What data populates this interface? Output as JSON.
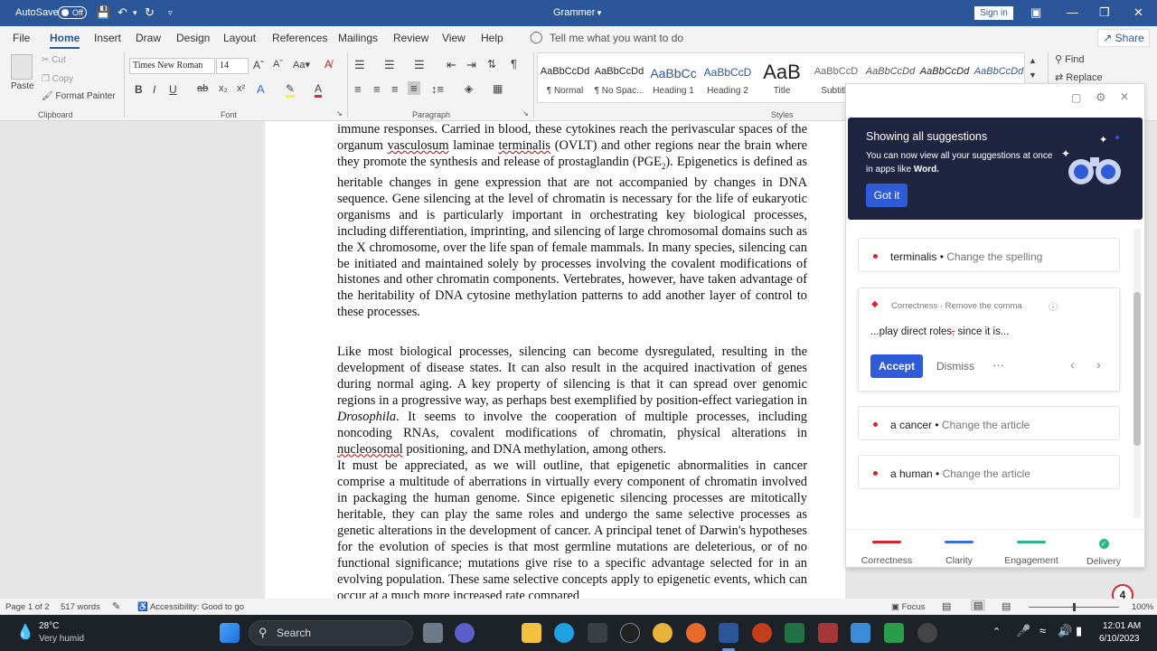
{
  "titlebar": {
    "autosave": "AutoSave",
    "toggle": "Off",
    "title": "Grammer",
    "signin": "Sign in"
  },
  "tabs": [
    "File",
    "Home",
    "Insert",
    "Draw",
    "Design",
    "Layout",
    "References",
    "Mailings",
    "Review",
    "View",
    "Help"
  ],
  "tellme": "Tell me what you want to do",
  "share": "Share",
  "ribbon": {
    "clipboard": {
      "paste": "Paste",
      "cut": "Cut",
      "copy": "Copy",
      "format_painter": "Format Painter",
      "label": "Clipboard"
    },
    "font": {
      "name": "Times New Roman",
      "size": "14",
      "label": "Font"
    },
    "paragraph": {
      "label": "Paragraph"
    },
    "styles": {
      "label": "Styles",
      "items": [
        {
          "preview": "AaBbCcDd",
          "name": "¶ Normal"
        },
        {
          "preview": "AaBbCcDd",
          "name": "¶ No Spac..."
        },
        {
          "preview": "AaBbCc",
          "name": "Heading 1"
        },
        {
          "preview": "AaBbCcD",
          "name": "Heading 2"
        },
        {
          "preview": "AaB",
          "name": "Title"
        },
        {
          "preview": "AaBbCcD",
          "name": "Subtitle"
        },
        {
          "preview": "AaBbCcDd",
          "name": ""
        },
        {
          "preview": "AaBbCcDd",
          "name": ""
        },
        {
          "preview": "AaBbCcDd",
          "name": ""
        }
      ]
    },
    "editing": {
      "find": "Find",
      "replace": "Replace"
    }
  },
  "document": {
    "p1_a": "immune responses. Carried in blood, these cytokines reach the perivascular spaces of the organum ",
    "p1_sq1": "vasculosum",
    "p1_b": " laminae ",
    "p1_sq2": "terminalis",
    "p1_c": " (OVLT) and other regions near the brain where they promote the synthesis and release of prostaglandin (PGE",
    "p1_sub": "2",
    "p1_d": "). Epigenetics is defined as heritable changes in gene expression that are not accompanied by changes in DNA sequence. Gene silencing at the level of chromatin is necessary for the life of eukaryotic organisms and is particularly important in orchestrating key biological processes, including differentiation, imprinting, and silencing of large chromosomal domains such as the X chromosome, over the life span of female mammals. In many species, silencing can be initiated and maintained solely by processes involving the covalent modifications of histones and other chromatin components. Vertebrates, however, have taken advantage of the heritability of DNA cytosine methylation patterns to add another layer of control to these processes.",
    "p2_a": "Like most biological processes, silencing can become dysregulated, resulting in the development of disease states. It can also result in the acquired inactivation of genes during normal aging. A key property of silencing is that it can spread over genomic regions in a progressive way, as perhaps best exemplified by position-effect variegation in ",
    "p2_it": "Drosophila",
    "p2_b": ". It seems to involve the cooperation of multiple processes, including noncoding RNAs, covalent modifications of chromatin, physical alterations in ",
    "p2_sq": "nucleosomal",
    "p2_c": " positioning, and DNA methylation, among others.",
    "p3": "It must be appreciated, as we will outline, that epigenetic abnormalities in cancer comprise a multitude of aberrations in virtually every component of chromatin involved in packaging the human genome. Since epigenetic silencing processes are mitotically heritable, they can play the same roles and undergo the same selective processes as genetic alterations in the development of cancer. A principal tenet of Darwin's hypotheses for the evolution of species is that most germline mutations are deleterious, or of no functional significance; mutations give rise to a specific advantage selected for in an evolving population. These same selective concepts apply to epigenetic events, which can occur at a much more increased rate compared"
  },
  "grammarly": {
    "banner": {
      "title": "Showing all suggestions",
      "body": "You can now view all your suggestions at once in apps like ",
      "body_bold": "Word.",
      "button": "Got it"
    },
    "cards": [
      {
        "word": "terminalis",
        "action": "Change the spelling"
      },
      {
        "category": "Correctness · Remove the comma",
        "preview_a": "...play direct roles",
        "preview_mark": ",",
        "preview_b": " since it is...",
        "accept": "Accept",
        "dismiss": "Dismiss",
        "more": "···"
      },
      {
        "word": "a cancer",
        "action": "Change the article"
      },
      {
        "word": "a human",
        "action": "Change the article"
      }
    ],
    "nav": [
      {
        "label": "Correctness",
        "color": "#d3262e"
      },
      {
        "label": "Clarity",
        "color": "#3b6fd4"
      },
      {
        "label": "Engagement",
        "color": "#2fb38a"
      },
      {
        "label": "Delivery",
        "color": "#5a9a3b"
      }
    ],
    "badge": "4"
  },
  "status": {
    "page": "Page 1 of 2",
    "words": "517 words",
    "accessibility": "Accessibility: Good to go",
    "focus": "Focus",
    "zoom": "100%"
  },
  "taskbar": {
    "temp": "28°C",
    "weather": "Very humid",
    "search": "Search",
    "time": "12:01 AM",
    "date": "6/10/2023"
  }
}
